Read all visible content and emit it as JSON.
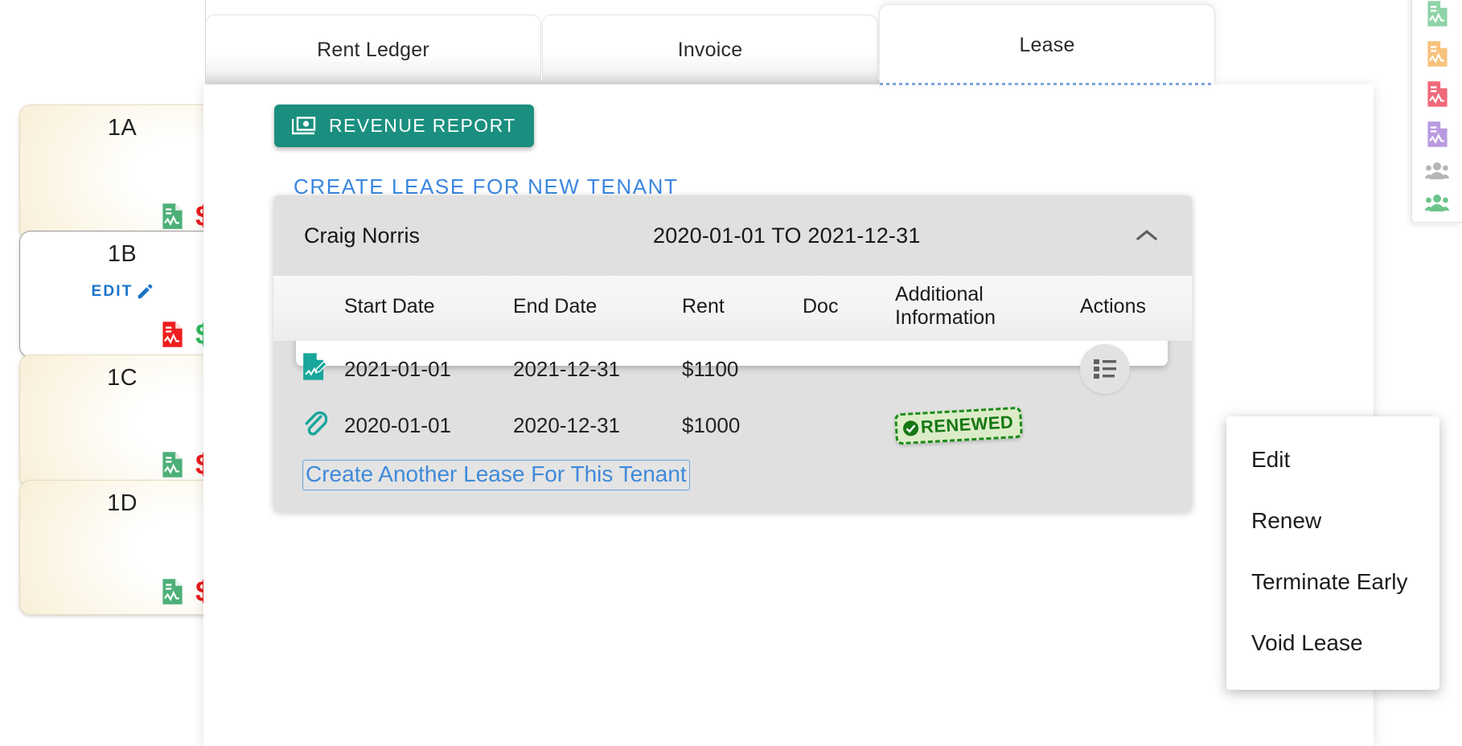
{
  "tabs": [
    {
      "label": "Rent Ledger",
      "active": false,
      "name": "tab-rent-ledger"
    },
    {
      "label": "Invoice",
      "active": false,
      "name": "tab-invoice"
    },
    {
      "label": "Lease",
      "active": true,
      "name": "tab-lease"
    }
  ],
  "units": [
    {
      "label": "1A",
      "state": "occupied",
      "edit_label": "",
      "doc_color": "#4caf78",
      "dollar_color": "#e81c1c"
    },
    {
      "label": "1B",
      "state": "vacant",
      "edit_label": "EDIT",
      "doc_color": "#f01e1e",
      "dollar_color": "#2eb85c"
    },
    {
      "label": "1C",
      "state": "occupied",
      "edit_label": "",
      "doc_color": "#4caf78",
      "dollar_color": "#e81c1c"
    },
    {
      "label": "1D",
      "state": "occupied",
      "edit_label": "",
      "doc_color": "#4caf78",
      "dollar_color": "#e81c1c"
    }
  ],
  "toolbar": {
    "revenue_report_label": "REVENUE REPORT",
    "revenue_report_color": "#1a8f7f"
  },
  "create_lease_link": "CREATE LEASE FOR NEW TENANT",
  "accordion": {
    "tenant_name": "Craig Norris",
    "date_range": "2020-01-01 TO 2021-12-31",
    "expanded": true
  },
  "table": {
    "headers": [
      "",
      "Start Date",
      "End Date",
      "Rent",
      "Doc",
      "Additional Information",
      "Actions"
    ],
    "rows": [
      {
        "icon": "lease-signed-icon",
        "start_date": "2021-01-01",
        "end_date": "2021-12-31",
        "rent": "$1100",
        "doc": "",
        "additional_information": "",
        "highlighted": true,
        "text_color": "#ff1515"
      },
      {
        "icon": "paperclip-icon",
        "start_date": "2020-01-01",
        "end_date": "2020-12-31",
        "rent": "$1000",
        "doc": "",
        "additional_information": "RENEWED",
        "highlighted": false,
        "text_color": "#222222"
      }
    ]
  },
  "create_another_lease_label": "Create Another Lease For This Tenant",
  "actions_menu": {
    "open": true,
    "items": [
      {
        "label": "Edit"
      },
      {
        "label": "Renew"
      },
      {
        "label": "Terminate  Early"
      },
      {
        "label": "Void Lease"
      }
    ]
  },
  "legend": [
    {
      "icon": "document-icon",
      "color": "#8fd3a8"
    },
    {
      "icon": "document-icon",
      "color": "#f7c27c"
    },
    {
      "icon": "document-icon",
      "color": "#f0697a"
    },
    {
      "icon": "document-icon",
      "color": "#b99ae0"
    },
    {
      "icon": "people-icon",
      "color": "#b6b6b6"
    },
    {
      "icon": "people-icon",
      "color": "#6cc48a"
    }
  ]
}
